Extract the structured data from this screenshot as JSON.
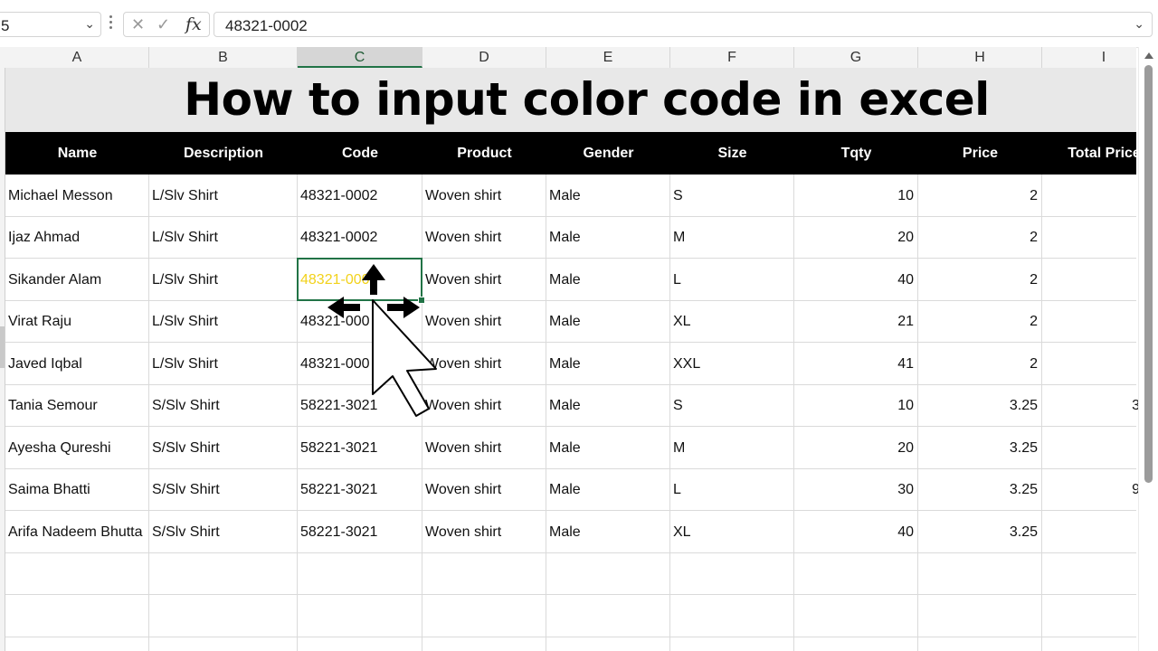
{
  "formula_bar": {
    "name_box": "5",
    "cancel_icon": "✕",
    "enter_icon": "✓",
    "fx_label": "fx",
    "value": "48321-0002"
  },
  "columns": [
    "A",
    "B",
    "C",
    "D",
    "E",
    "F",
    "G",
    "H",
    "I"
  ],
  "active_column": "C",
  "title": "How to input color code in excel",
  "table": {
    "headers": [
      "Name",
      "Description",
      "Code",
      "Product",
      "Gender",
      "Size",
      "Tqty",
      "Price",
      "Total Price"
    ],
    "rows": [
      [
        "Michael Messon",
        "L/Slv Shirt",
        "48321-0002",
        "Woven shirt",
        "Male",
        "S",
        "10",
        "2",
        ""
      ],
      [
        "Ijaz Ahmad",
        "L/Slv Shirt",
        "48321-0002",
        "Woven shirt",
        "Male",
        "M",
        "20",
        "2",
        ""
      ],
      [
        "Sikander Alam",
        "L/Slv Shirt",
        "48321-0002",
        "Woven shirt",
        "Male",
        "L",
        "40",
        "2",
        ""
      ],
      [
        "Virat Raju",
        "L/Slv Shirt",
        "48321-000",
        "Woven shirt",
        "Male",
        "XL",
        "21",
        "2",
        ""
      ],
      [
        "Javed Iqbal",
        "L/Slv Shirt",
        "48321-000",
        "Woven shirt",
        "Male",
        "XXL",
        "41",
        "2",
        ""
      ],
      [
        "Tania Semour",
        "S/Slv Shirt",
        "58221-3021",
        "Woven shirt",
        "Male",
        "S",
        "10",
        "3.25",
        "3"
      ],
      [
        "Ayesha Qureshi",
        "S/Slv Shirt",
        "58221-3021",
        "Woven shirt",
        "Male",
        "M",
        "20",
        "3.25",
        ""
      ],
      [
        "Saima Bhatti",
        "S/Slv Shirt",
        "58221-3021",
        "Woven shirt",
        "Male",
        "L",
        "30",
        "3.25",
        "9"
      ],
      [
        "Arifa Nadeem Bhutta",
        "S/Slv Shirt",
        "58221-3021",
        "Woven shirt",
        "Male",
        "XL",
        "40",
        "3.25",
        ""
      ]
    ],
    "selected_cell_text": "48321-0002",
    "selected_text_color": "#f2d21b"
  },
  "colors": {
    "accent": "#217346",
    "header_bg": "#000000",
    "title_bg": "#e8e8e8"
  },
  "icons": {
    "namebox_dropdown": "chevron-down-icon",
    "formula_expand": "chevron-down-icon",
    "cursor": "move-cursor-icon"
  }
}
